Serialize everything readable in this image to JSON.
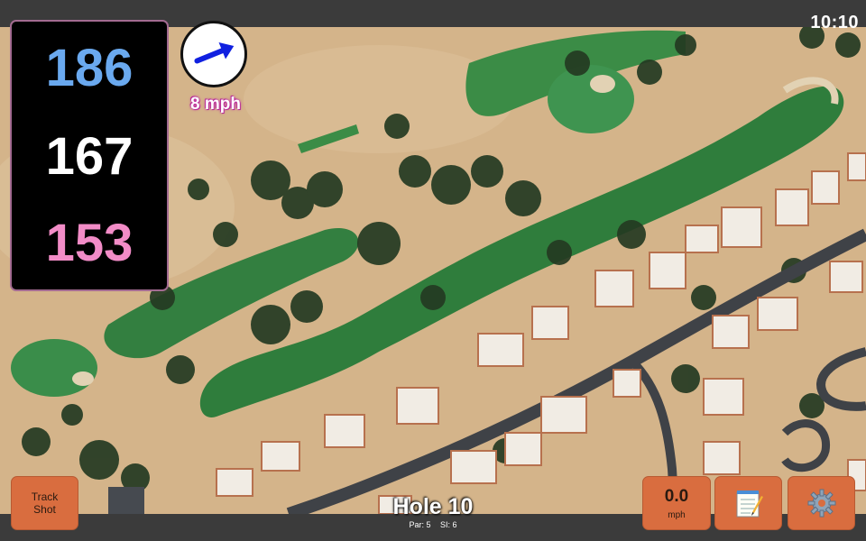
{
  "status": {
    "time": "10:10"
  },
  "distances": {
    "back": "186",
    "middle": "167",
    "front": "153"
  },
  "wind": {
    "speed": "8 mph",
    "icon": "wind-arrow-icon",
    "direction_deg": 340
  },
  "buttons": {
    "track_shot": {
      "line1": "Track",
      "line2": "Shot"
    },
    "speed": {
      "value": "0.0",
      "unit": "mph"
    },
    "notes_icon": "notepad-icon",
    "settings_icon": "gear-icon"
  },
  "hole": {
    "title": "Hole 10",
    "par": "Par: 5",
    "si": "SI: 6"
  },
  "colors": {
    "back": "#6aa9ef",
    "middle": "#ffffff",
    "front": "#f28cc7",
    "button": "#d96d3f",
    "fairway": "#2f7d3c",
    "sand": "#d8b890"
  }
}
